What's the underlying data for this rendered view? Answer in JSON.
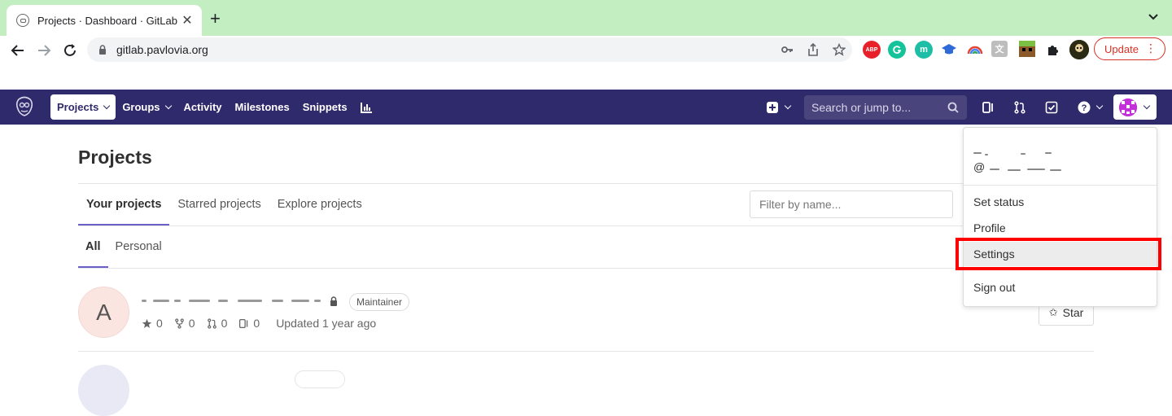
{
  "browser": {
    "tab_title": "Projects · Dashboard · GitLab",
    "tab_close": "✕",
    "new_tab": "+",
    "url": "gitlab.pavlovia.org",
    "extensions": [
      {
        "icon": "adblock-plus-icon",
        "label": "ABP",
        "color": "#e8202a"
      },
      {
        "icon": "grammarly-icon",
        "label": "",
        "color": "#15c39a"
      },
      {
        "icon": "mendeley-icon",
        "label": "m",
        "color": "#1cbfa6"
      },
      {
        "icon": "graduation-cap-icon",
        "label": "",
        "color": "#2f6bd7"
      },
      {
        "icon": "rainbow-icon",
        "label": "",
        "color": "#ffffff"
      },
      {
        "icon": "translate-icon",
        "label": "",
        "color": "#9e9e9e"
      },
      {
        "icon": "minecraft-icon",
        "label": "",
        "color": "#5c9e31"
      },
      {
        "icon": "puzzle-icon",
        "label": "",
        "color": "#ffffff"
      },
      {
        "icon": "profile-avatar-icon",
        "label": "",
        "color": "#3a3a1a"
      }
    ],
    "update_label": "Update",
    "menu_dots": "⋮"
  },
  "header": {
    "nav": [
      {
        "label": "Projects",
        "active": true,
        "dropdown": true
      },
      {
        "label": "Groups",
        "active": false,
        "dropdown": true
      },
      {
        "label": "Activity",
        "active": false,
        "dropdown": false
      },
      {
        "label": "Milestones",
        "active": false,
        "dropdown": false
      },
      {
        "label": "Snippets",
        "active": false,
        "dropdown": false
      }
    ],
    "search_placeholder": "Search or jump to...",
    "brand_color": "#2f2a6b"
  },
  "page": {
    "title": "Projects",
    "tabs": [
      "Your projects",
      "Starred projects",
      "Explore projects"
    ],
    "filter_placeholder": "Filter by name...",
    "subtabs": [
      "All",
      "Personal"
    ],
    "accent_color": "#6b60c8"
  },
  "project": {
    "avatar_letter": "A",
    "role": "Maintainer",
    "stars": "0",
    "forks": "0",
    "merge_requests": "0",
    "issues": "0",
    "updated": "Updated 1 year ago",
    "star_button": "Star",
    "star_symbol": "✩"
  },
  "user_menu": {
    "handle_prefix": "@",
    "items": [
      "Set status",
      "Profile",
      "Settings",
      "Sign out"
    ],
    "highlighted_item": "Settings",
    "highlight_color": "#ff0000"
  }
}
